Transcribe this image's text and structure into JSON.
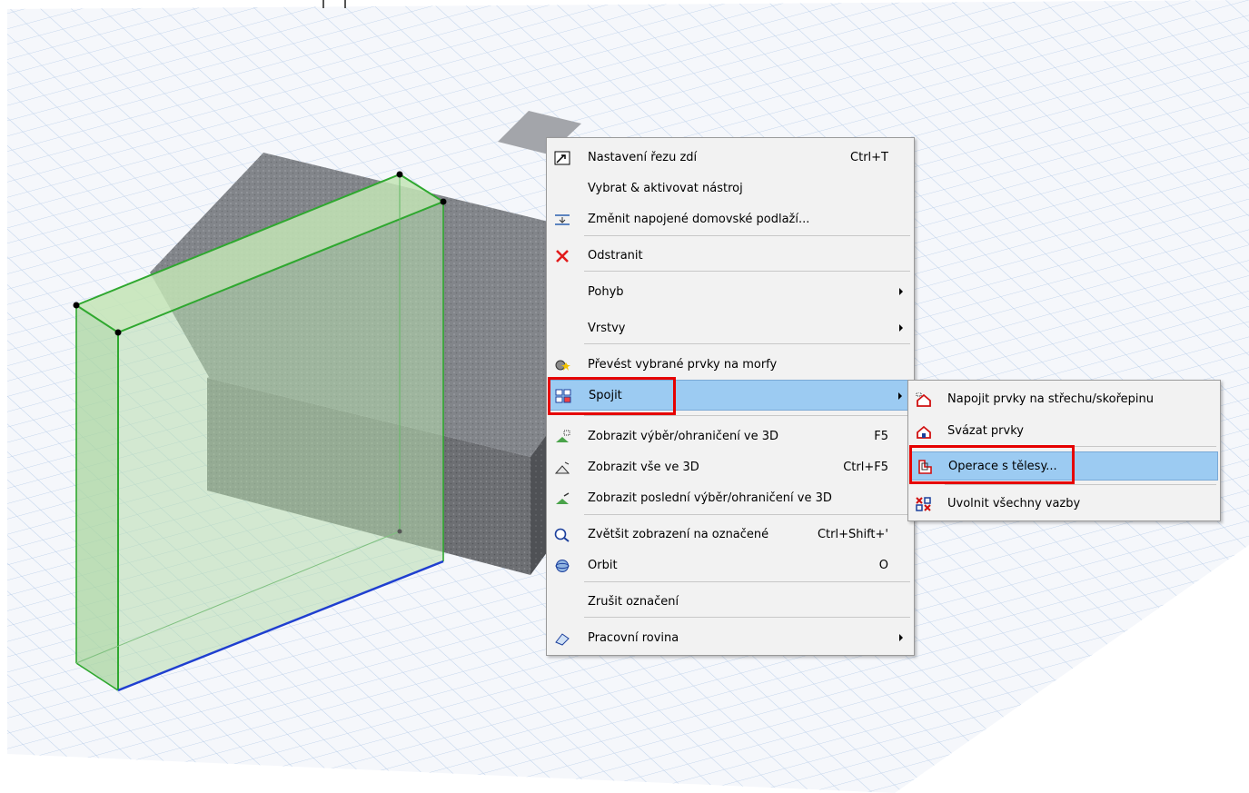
{
  "context_menu": {
    "items": [
      {
        "label": "Nastavení řezu zdí",
        "shortcut": "Ctrl+T",
        "icon": "wall-section-settings-icon"
      },
      {
        "label": "Vybrat & aktivovat nástroj",
        "shortcut": "",
        "icon": ""
      },
      {
        "label": "Změnit napojené domovské podlaží...",
        "shortcut": "",
        "icon": "home-story-icon"
      },
      {
        "label": "Odstranit",
        "shortcut": "",
        "icon": "delete-x-icon"
      },
      {
        "label": "Pohyb",
        "shortcut": "",
        "icon": ""
      },
      {
        "label": "Vrstvy",
        "shortcut": "",
        "icon": ""
      },
      {
        "label": "Převést vybrané prvky na morfy",
        "shortcut": "",
        "icon": "convert-morph-icon"
      },
      {
        "label": "Spojit",
        "shortcut": "",
        "icon": "connect-icon"
      },
      {
        "label": "Zobrazit výběr/ohraničení ve 3D",
        "shortcut": "F5",
        "icon": "show-selection-3d-icon"
      },
      {
        "label": "Zobrazit vše ve 3D",
        "shortcut": "Ctrl+F5",
        "icon": "show-all-3d-icon"
      },
      {
        "label": "Zobrazit poslední výběr/ohraničení ve 3D",
        "shortcut": "",
        "icon": "show-last-selection-3d-icon"
      },
      {
        "label": "Zvětšit zobrazení na označené",
        "shortcut": "Ctrl+Shift+'",
        "icon": "zoom-selection-icon"
      },
      {
        "label": "Orbit",
        "shortcut": "O",
        "icon": "orbit-icon"
      },
      {
        "label": "Zrušit označení",
        "shortcut": "",
        "icon": ""
      },
      {
        "label": "Pracovní rovina",
        "shortcut": "",
        "icon": "working-plane-icon"
      }
    ]
  },
  "submenu": {
    "items": [
      {
        "label": "Napojit prvky na střechu/skořepinu",
        "icon": "trim-to-roof-icon"
      },
      {
        "label": "Svázat prvky",
        "icon": "link-elements-icon"
      },
      {
        "label": "Operace s tělesy...",
        "icon": "solid-operations-icon"
      },
      {
        "label": "Uvolnit všechny vazby",
        "icon": "release-links-icon"
      }
    ]
  },
  "colors": {
    "highlight": "#9ccbf2",
    "callout": "#e60000",
    "selection_green": "#2fa82f",
    "selection_blue": "#1f3fd0"
  }
}
